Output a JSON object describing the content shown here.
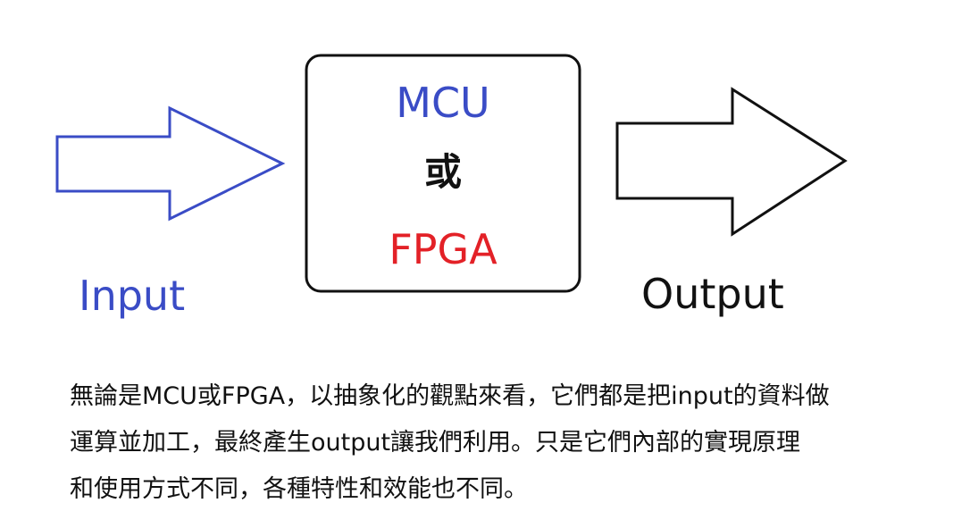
{
  "diagram": {
    "input_label": "Input",
    "output_label": "Output",
    "box": {
      "line1": "MCU",
      "line2": "或",
      "line3": "FPGA"
    },
    "description_lines": [
      "無論是MCU或FPGA，以抽象化的觀點來看，它們都是把input的資料做",
      "運算並加工，最終產生output讓我們利用。只是它們內部的實現原理",
      "和使用方式不同，各種特性和效能也不同。"
    ]
  },
  "colors": {
    "input_blue": "#3a4cc6",
    "fpga_red": "#e32127",
    "outline_black": "#111111"
  }
}
